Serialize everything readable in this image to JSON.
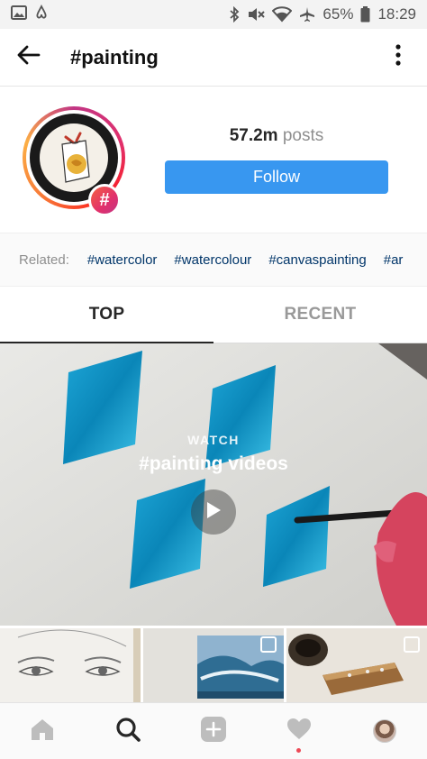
{
  "status_bar": {
    "battery": "65%",
    "time": "18:29",
    "left_icons": [
      "image-icon",
      "airbnb-icon"
    ],
    "right_icons": [
      "bluetooth-icon",
      "mute-icon",
      "wifi-icon",
      "airplane-icon",
      "battery-icon"
    ]
  },
  "header": {
    "title": "#painting",
    "back_icon": "arrow-left-icon",
    "more_icon": "vertical-dots-icon"
  },
  "profile": {
    "posts_count": "57.2m",
    "posts_label": "posts",
    "follow_label": "Follow",
    "badge_symbol": "#"
  },
  "related": {
    "label": "Related:",
    "tags": [
      "#watercolor",
      "#watercolour",
      "#canvaspainting",
      "#ar"
    ]
  },
  "tabs": [
    {
      "label": "TOP",
      "active": true
    },
    {
      "label": "RECENT",
      "active": false
    }
  ],
  "featured": {
    "watch_label": "WATCH",
    "title": "#painting videos"
  },
  "bottom_nav": {
    "items": [
      "home-icon",
      "search-icon",
      "add-icon",
      "heart-icon",
      "profile-avatar"
    ]
  },
  "colors": {
    "follow_blue": "#3897f0",
    "related_tag": "#003569",
    "notification_red": "#ed4956"
  }
}
